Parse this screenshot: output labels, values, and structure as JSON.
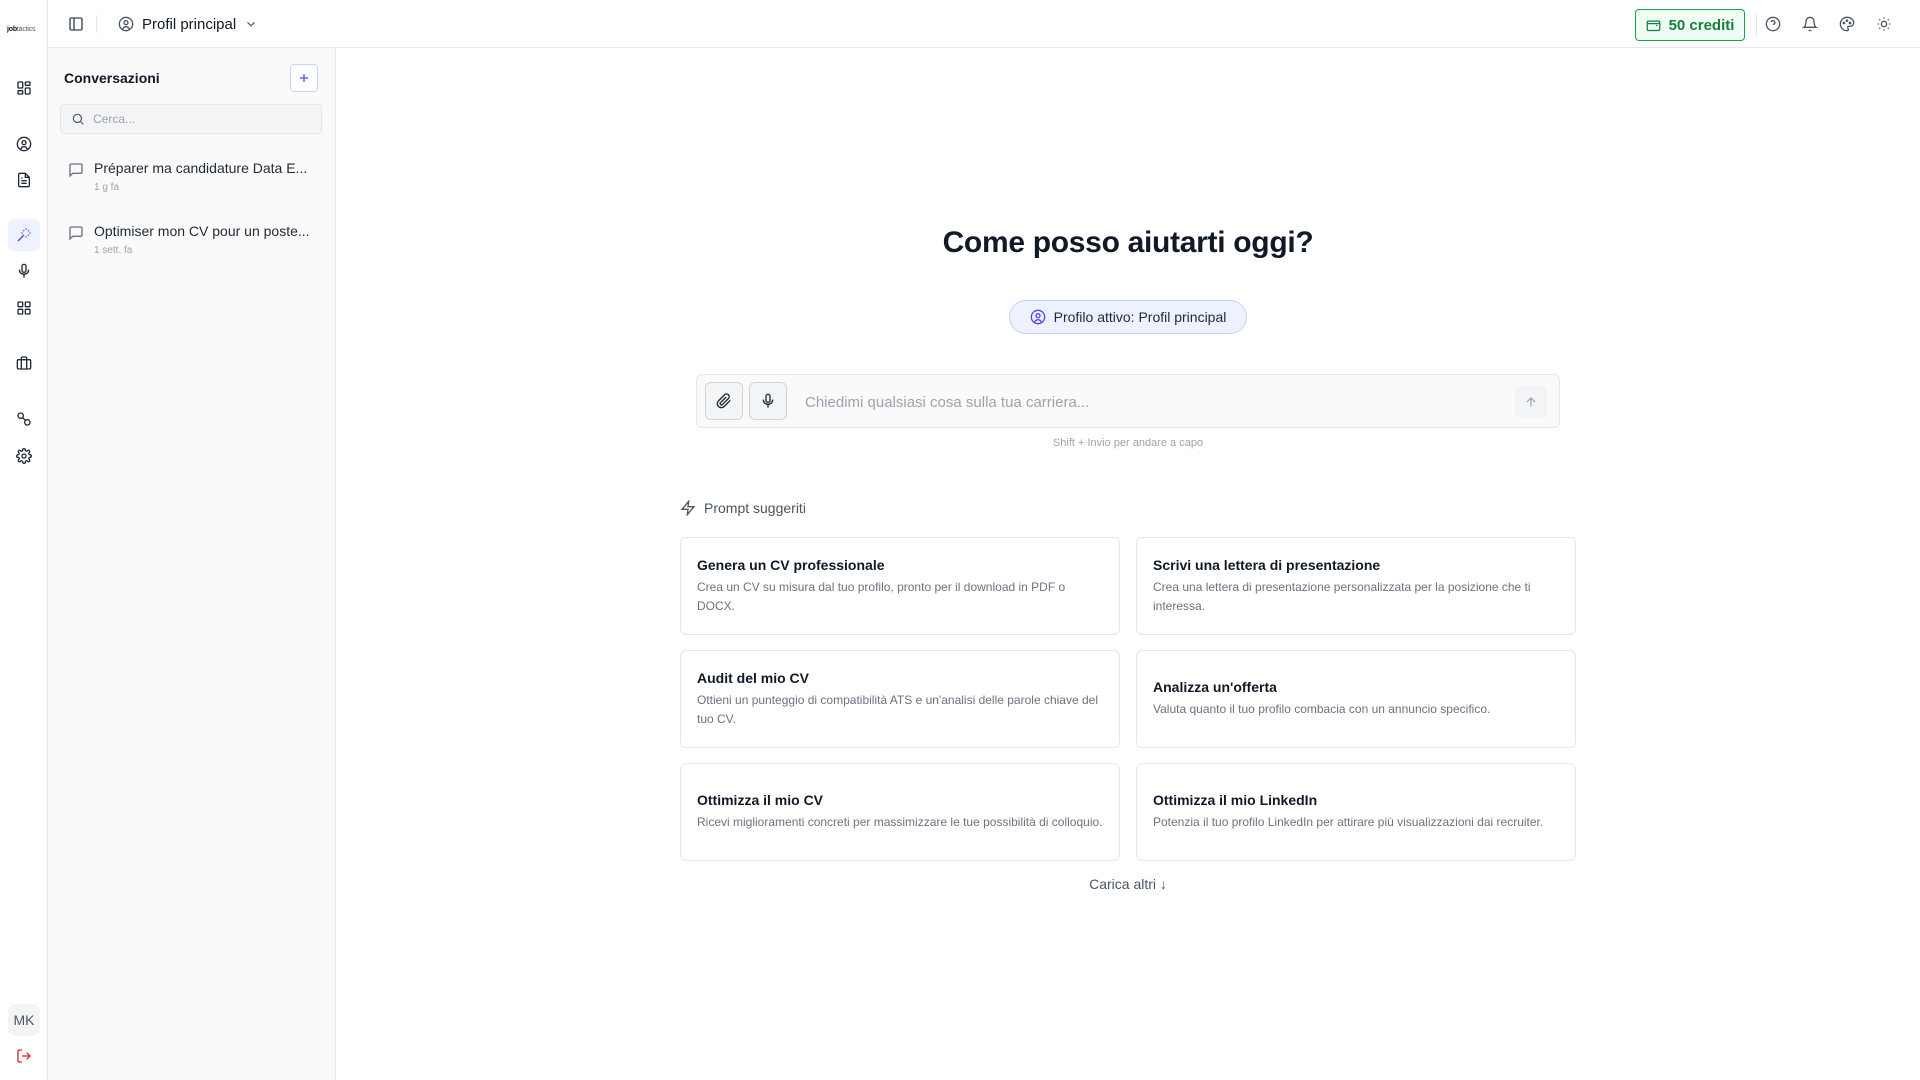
{
  "app": {
    "logo_bold": "job",
    "logo_thin": "tactics"
  },
  "rail": {
    "items": [
      {
        "icon": "dashboard-icon"
      },
      {
        "icon": "user-circle-icon"
      },
      {
        "icon": "document-icon"
      },
      {
        "icon": "magic-wand-icon",
        "active": true
      },
      {
        "icon": "microphone-icon"
      },
      {
        "icon": "grid-icon"
      },
      {
        "icon": "briefcase-icon"
      },
      {
        "icon": "link-icon"
      },
      {
        "icon": "gear-icon"
      }
    ],
    "avatar_initials": "MK"
  },
  "topbar": {
    "profile_label": "Profil principal",
    "credits_label": "50 crediti"
  },
  "conversations": {
    "title": "Conversazioni",
    "search_placeholder": "Cerca...",
    "items": [
      {
        "title": "Préparer ma candidature Data E...",
        "time": "1 g fa"
      },
      {
        "title": "Optimiser mon CV pour un poste...",
        "time": "1 sett. fa"
      }
    ]
  },
  "main": {
    "heading": "Come posso aiutarti oggi?",
    "active_profile": "Profilo attivo: Profil principal",
    "composer_placeholder": "Chiedimi qualsiasi cosa sulla tua carriera...",
    "hint": "Shift + Invio per andare a capo",
    "suggestions_label": "Prompt suggeriti",
    "suggestions": [
      {
        "title": "Genera un CV professionale",
        "desc": "Crea un CV su misura dal tuo profilo, pronto per il download in PDF o DOCX."
      },
      {
        "title": "Scrivi una lettera di presentazione",
        "desc": "Crea una lettera di presentazione personalizzata per la posizione che ti interessa."
      },
      {
        "title": "Audit del mio CV",
        "desc": "Ottieni un punteggio di compatibilità ATS e un'analisi delle parole chiave del tuo CV."
      },
      {
        "title": "Analizza un'offerta",
        "desc": "Valuta quanto il tuo profilo combacia con un annuncio specifico."
      },
      {
        "title": "Ottimizza il mio CV",
        "desc": "Ricevi miglioramenti concreti per massimizzare le tue possibilità di colloquio."
      },
      {
        "title": "Ottimizza il mio LinkedIn",
        "desc": "Potenzia il tuo profilo LinkedIn per attirare più visualizzazioni dai recruiter."
      }
    ],
    "load_more": "Carica altri ↓"
  },
  "colors": {
    "accent": "#4f46e5",
    "credits": "#15803d",
    "logout": "#dc2626"
  }
}
